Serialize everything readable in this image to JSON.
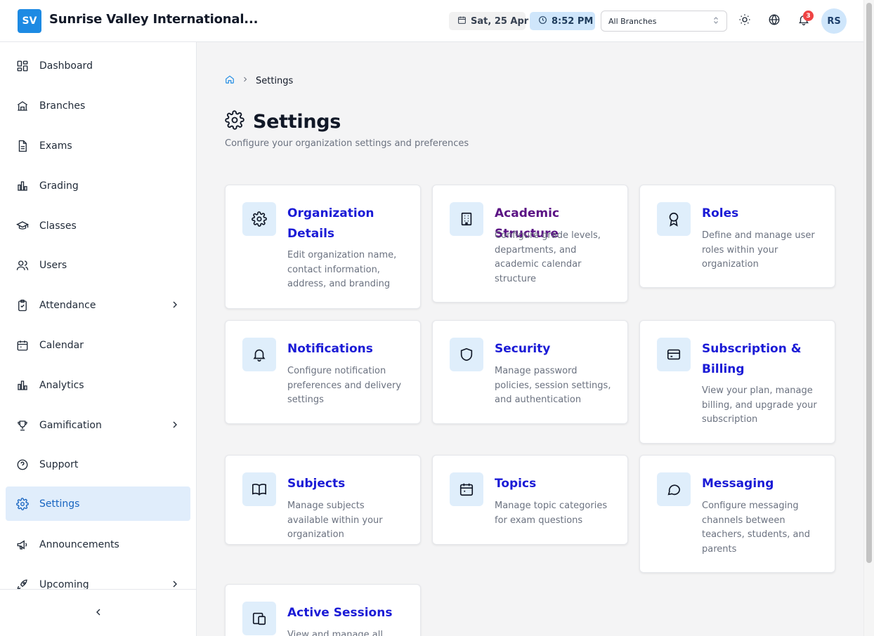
{
  "header": {
    "logo_initials": "SV",
    "org_name": "Sunrise Valley International...",
    "date": "Sat, 25 Apr",
    "time": "8:52 PM",
    "branch_select": "All Branches",
    "notification_count": "3",
    "user_initials": "RS"
  },
  "sidebar": {
    "items": [
      {
        "label": "Dashboard",
        "icon": "dashboard-icon"
      },
      {
        "label": "Branches",
        "icon": "building-icon"
      },
      {
        "label": "Exams",
        "icon": "document-icon"
      },
      {
        "label": "Grading",
        "icon": "bar-chart-icon"
      },
      {
        "label": "Classes",
        "icon": "graduation-cap-icon"
      },
      {
        "label": "Users",
        "icon": "users-icon"
      },
      {
        "label": "Attendance",
        "icon": "clipboard-check-icon"
      },
      {
        "label": "Calendar",
        "icon": "calendar-icon"
      },
      {
        "label": "Analytics",
        "icon": "bar-chart-icon"
      },
      {
        "label": "Gamification",
        "icon": "trophy-icon"
      },
      {
        "label": "Support",
        "icon": "help-circle-icon"
      },
      {
        "label": "Settings",
        "icon": "gear-icon",
        "active": true
      },
      {
        "label": "Announcements",
        "icon": "megaphone-icon"
      },
      {
        "label": "Upcoming",
        "icon": "rocket-icon"
      }
    ]
  },
  "breadcrumb": {
    "current": "Settings"
  },
  "page": {
    "title": "Settings",
    "subtitle": "Configure your organization settings and preferences"
  },
  "cards": [
    {
      "title": "Organization Details",
      "description": "Edit organization name, contact information, address, and branding",
      "icon": "gear-icon"
    },
    {
      "title": "Academic Structure",
      "description": "Configure grade levels, departments, and academic calendar structure",
      "icon": "building-icon"
    },
    {
      "title": "Roles",
      "description": "Define and manage user roles within your organization",
      "icon": "award-icon"
    },
    {
      "title": "Notifications",
      "description": "Configure notification preferences and delivery settings",
      "icon": "bell-icon"
    },
    {
      "title": "Security",
      "description": "Manage password policies, session settings, and authentication",
      "icon": "shield-icon"
    },
    {
      "title": "Subscription & Billing",
      "description": "View your plan, manage billing, and upgrade your subscription",
      "icon": "credit-card-icon"
    },
    {
      "title": "Subjects",
      "description": "Manage subjects available within your organization",
      "icon": "book-icon"
    },
    {
      "title": "Topics",
      "description": "Manage topic categories for exam questions",
      "icon": "calendar-icon"
    },
    {
      "title": "Messaging",
      "description": "Configure messaging channels between teachers, students, and parents",
      "icon": "message-icon"
    },
    {
      "title": "Active Sessions",
      "description": "View and manage all",
      "icon": "devices-icon"
    }
  ],
  "colors": {
    "accent": "#1d8ae3",
    "link": "#1b1bd6",
    "visited_link": "#5b1384",
    "active_nav_bg": "#e0edfb",
    "icon_tile_bg": "#dfeefb",
    "badge": "#ef4444"
  }
}
